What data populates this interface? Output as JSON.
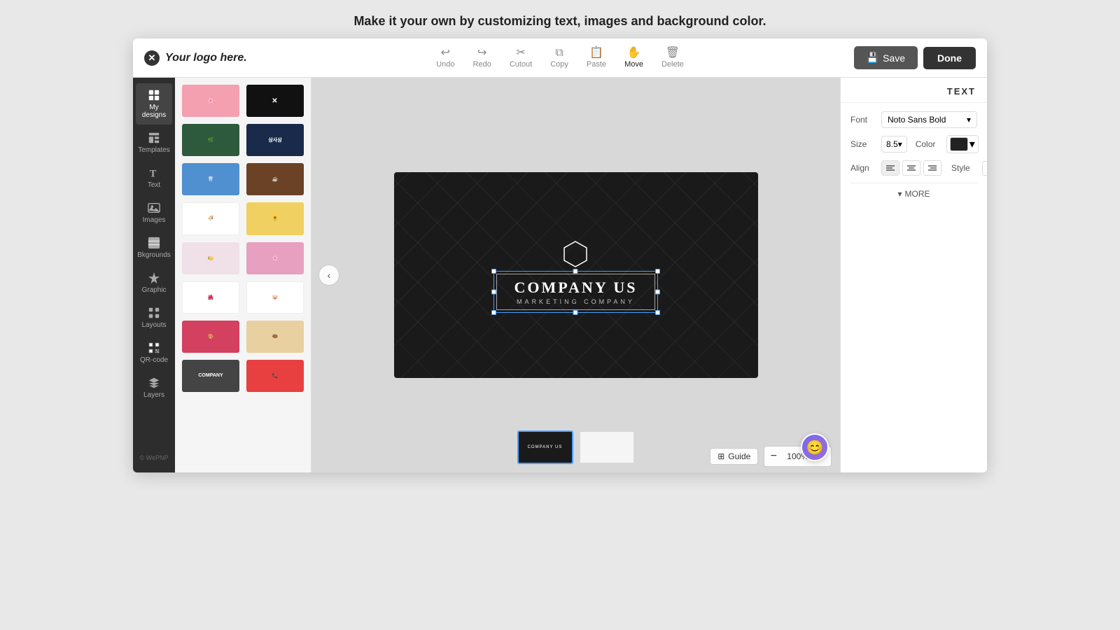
{
  "page": {
    "top_message": "Make it your own by customizing text, images and background color.",
    "logo_text": "Your logo here."
  },
  "toolbar": {
    "tools": [
      {
        "id": "undo",
        "label": "Undo",
        "icon": "↩"
      },
      {
        "id": "redo",
        "label": "Redo",
        "icon": "↪"
      },
      {
        "id": "cutout",
        "label": "Cutout",
        "icon": "✂"
      },
      {
        "id": "copy",
        "label": "Copy",
        "icon": "⧉"
      },
      {
        "id": "paste",
        "label": "Paste",
        "icon": "📋"
      },
      {
        "id": "move",
        "label": "Move",
        "icon": "✋"
      },
      {
        "id": "delete",
        "label": "Delete",
        "icon": "🗑"
      }
    ],
    "save_label": "Save",
    "done_label": "Done"
  },
  "sidebar": {
    "items": [
      {
        "id": "my-designs",
        "label": "My designs",
        "icon": "⊞"
      },
      {
        "id": "templates",
        "label": "Templates",
        "icon": "▦"
      },
      {
        "id": "text",
        "label": "Text",
        "icon": "T"
      },
      {
        "id": "images",
        "label": "Images",
        "icon": "🖼"
      },
      {
        "id": "backgrounds",
        "label": "Bkgrounds",
        "icon": "▤"
      },
      {
        "id": "graphic",
        "label": "Graphic",
        "icon": "✦"
      },
      {
        "id": "layouts",
        "label": "Layouts",
        "icon": "⊞"
      },
      {
        "id": "qr-code",
        "label": "QR-code",
        "icon": "▦"
      },
      {
        "id": "layers",
        "label": "Layers",
        "icon": "⊟"
      }
    ],
    "copyright": "© WePNP"
  },
  "canvas": {
    "company_name": "COMPANY US",
    "company_sub": "MARKETING COMPANY",
    "zoom": "100%",
    "guide_label": "Guide"
  },
  "text_panel": {
    "title": "TEXT",
    "font_label": "Font",
    "font_value": "Noto Sans Bold",
    "size_label": "Size",
    "size_value": "8.5",
    "color_label": "Color",
    "align_label": "Align",
    "style_label": "Style",
    "more_label": "MORE"
  },
  "pages": [
    {
      "id": "page-1",
      "active": true
    },
    {
      "id": "page-2",
      "active": false
    }
  ]
}
